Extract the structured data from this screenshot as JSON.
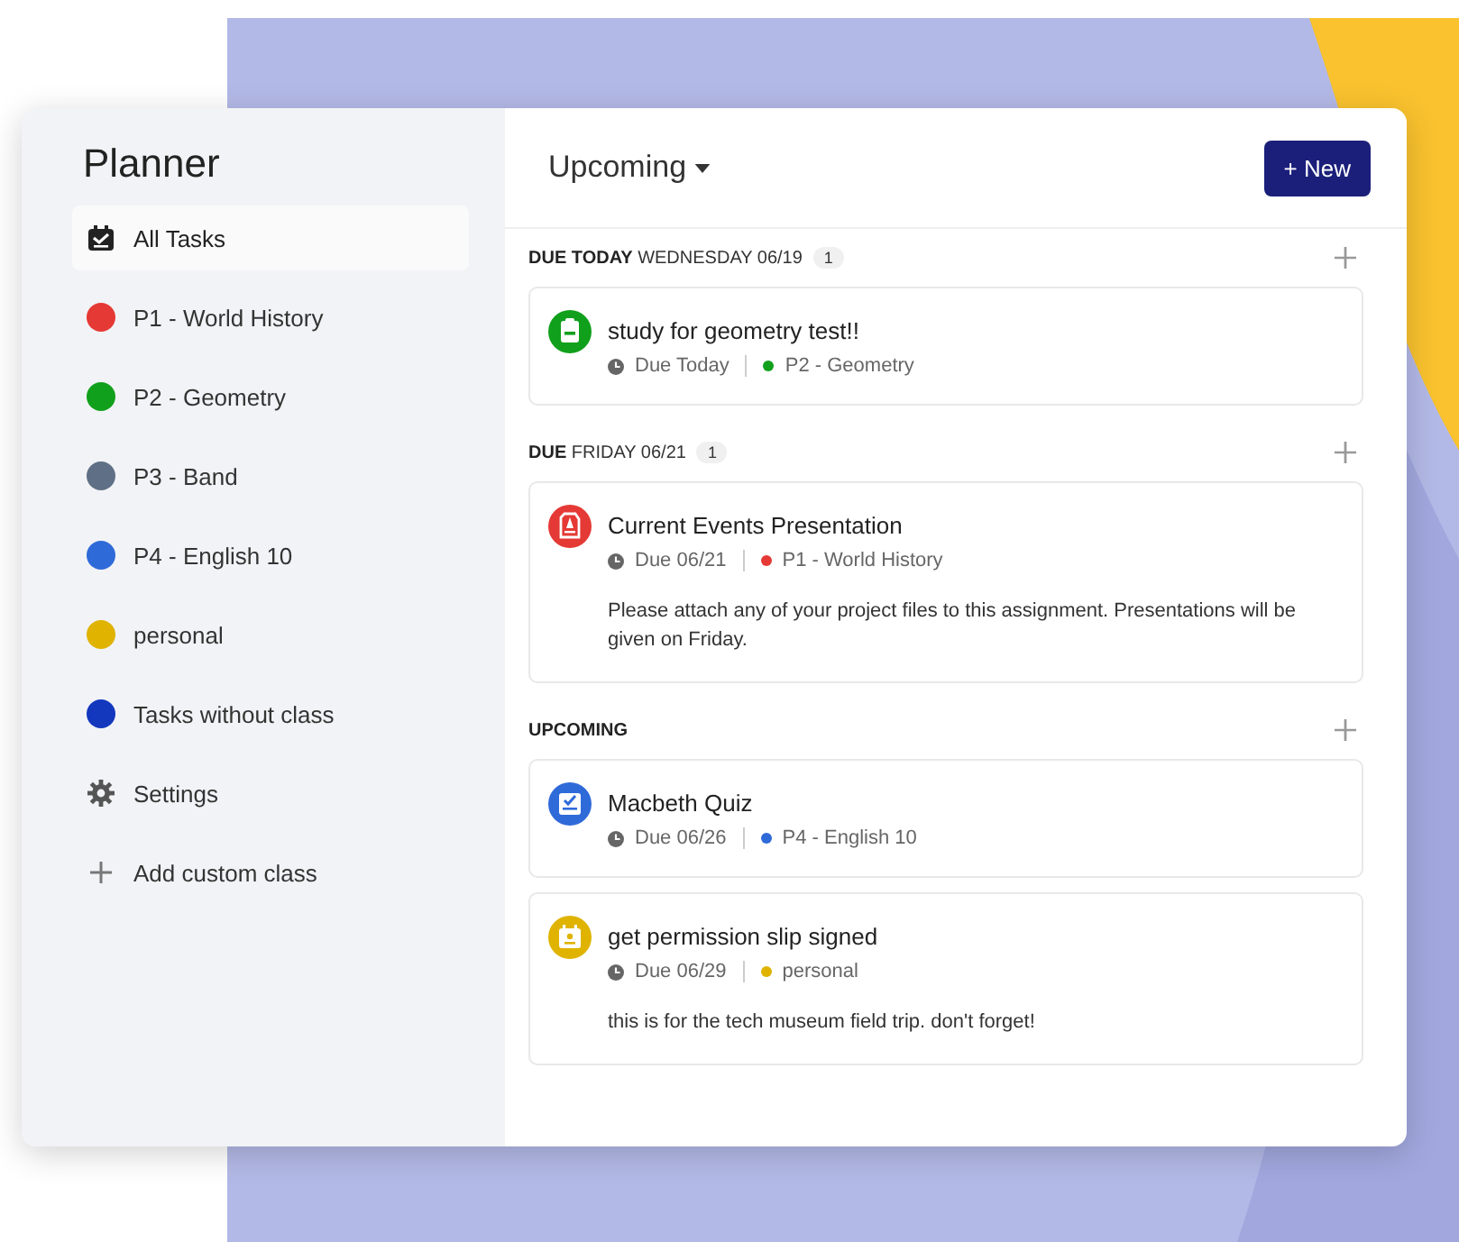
{
  "sidebar": {
    "title": "Planner",
    "items": [
      {
        "kind": "all",
        "label": "All Tasks",
        "selected": true
      },
      {
        "kind": "class",
        "label": "P1 - World History",
        "color": "#e53935",
        "selected": false
      },
      {
        "kind": "class",
        "label": "P2 - Geometry",
        "color": "#11a01c",
        "selected": false
      },
      {
        "kind": "class",
        "label": "P3 - Band",
        "color": "#5f7086",
        "selected": false
      },
      {
        "kind": "class",
        "label": "P4 - English 10",
        "color": "#2f6ad9",
        "selected": false
      },
      {
        "kind": "class",
        "label": "personal",
        "color": "#dfb300",
        "selected": false
      },
      {
        "kind": "class",
        "label": "Tasks without class",
        "color": "#1338be",
        "selected": false
      },
      {
        "kind": "settings",
        "label": "Settings",
        "selected": false
      },
      {
        "kind": "add",
        "label": "Add custom class",
        "selected": false
      }
    ]
  },
  "main": {
    "view": "Upcoming",
    "new_button": "+ New",
    "sections": [
      {
        "heading": "**DUE TODAY** WEDNESDAY 06/19",
        "count": "1",
        "tasks": [
          {
            "kind": "clipboard",
            "color": "#11a01c",
            "title": "study for geometry test!!",
            "due": "Due Today",
            "class": "P2 - Geometry"
          }
        ]
      },
      {
        "heading": "**DUE** FRIDAY 06/21",
        "count": "1",
        "tasks": [
          {
            "kind": "document",
            "color": "#e53935",
            "title": "Current Events Presentation",
            "due": "Due 06/21",
            "class": "P1 - World History",
            "note": "Please attach any of your project files to this assignment. Presentations will be given on Friday."
          }
        ]
      },
      {
        "heading": "**UPCOMING**",
        "tasks": [
          {
            "kind": "checklist",
            "color": "#2f6ad9",
            "title": "Macbeth Quiz",
            "due": "Due 06/26",
            "class": "P4 - English 10"
          },
          {
            "kind": "calendar",
            "color": "#dfb300",
            "title": "get permission slip signed",
            "due": "Due 06/29",
            "class": "personal",
            "note": "this is for the tech museum field trip. don't forget!"
          }
        ]
      }
    ]
  }
}
